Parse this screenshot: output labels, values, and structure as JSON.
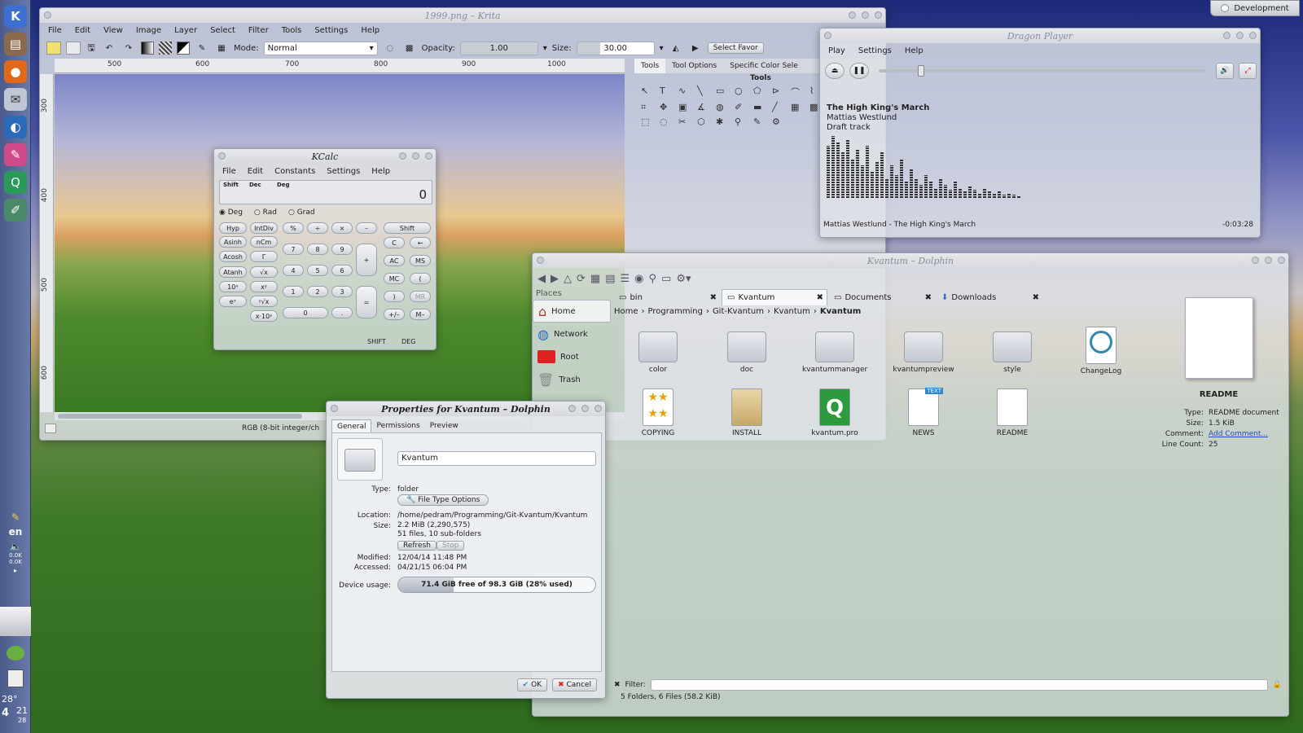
{
  "panel": {
    "lang": "en",
    "net_up": "0.0K",
    "net_down": "0.0K",
    "weather": "28°",
    "clock_min": "21",
    "clock_sec": "28",
    "clock_hour": "4"
  },
  "activity": "Development",
  "krita": {
    "title": "1999.png – Krita",
    "menu": [
      "File",
      "Edit",
      "View",
      "Image",
      "Layer",
      "Select",
      "Filter",
      "Tools",
      "Settings",
      "Help"
    ],
    "mode_label": "Mode:",
    "mode_value": "Normal",
    "opacity_label": "Opacity:",
    "opacity_value": "1.00",
    "size_label": "Size:",
    "size_value": "30.00",
    "select_favorite": "Select Favor",
    "ruler_h": [
      "500",
      "600",
      "700",
      "800",
      "900",
      "1000"
    ],
    "ruler_v": [
      "300",
      "400",
      "500",
      "600"
    ],
    "status": "RGB (8-bit integer/ch",
    "docker_tabs": [
      "Tools",
      "Tool Options",
      "Specific Color Sele"
    ],
    "docker_title": "Tools"
  },
  "kcalc": {
    "title": "KCalc",
    "menu": [
      "File",
      "Edit",
      "Constants",
      "Settings",
      "Help"
    ],
    "status_flags": [
      "Shift",
      "Dec",
      "Deg"
    ],
    "display": "0",
    "angle": [
      "Deg",
      "Rad",
      "Grad"
    ],
    "buttons": {
      "hyp": "Hyp",
      "intdiv": "IntDiv",
      "pct": "%",
      "div": "÷",
      "mul": "×",
      "sub": "–",
      "shift": "Shift",
      "asinh": "Asinh",
      "ncm": "nCm",
      "n7": "7",
      "n8": "8",
      "n9": "9",
      "add": "+",
      "c": "C",
      "back": "←",
      "acosh": "Acosh",
      "gamma": "Γ",
      "n4": "4",
      "n5": "5",
      "n6": "6",
      "ac": "AC",
      "ms": "MS",
      "atanh": "Atanh",
      "sqrt": "√x",
      "n1": "1",
      "n2": "2",
      "n3": "3",
      "mc": "MC",
      "lp": "(",
      "tenx": "10ˣ",
      "xy": "xʸ",
      "n0": "0",
      "dot": ".",
      "eq": "=",
      "rp": ")",
      "mr": "MR",
      "ex": "eˣ",
      "root": "ʸ√x",
      "exp": "x·10ʸ",
      "pm": "+/–",
      "mminus": "M–"
    },
    "footer_shift": "SHIFT",
    "footer_deg": "DEG"
  },
  "dragon": {
    "title": "Dragon Player",
    "menu": [
      "Play",
      "Settings",
      "Help"
    ],
    "track_title": "The High King's March",
    "artist": "Mattias Westlund",
    "album": "Draft track",
    "status": "Mattias Westlund - The High King's March",
    "time": "-0:03:28",
    "progress": 0.12,
    "spectrum": [
      0.8,
      0.95,
      0.85,
      0.7,
      0.9,
      0.6,
      0.75,
      0.5,
      0.8,
      0.4,
      0.55,
      0.7,
      0.3,
      0.5,
      0.35,
      0.6,
      0.25,
      0.45,
      0.3,
      0.2,
      0.35,
      0.25,
      0.15,
      0.3,
      0.2,
      0.12,
      0.25,
      0.15,
      0.1,
      0.18,
      0.12,
      0.08,
      0.14,
      0.1,
      0.06,
      0.1,
      0.05,
      0.08,
      0.05,
      0.04
    ]
  },
  "dolphin": {
    "title": "Kvantum – Dolphin",
    "places_label": "Places",
    "places": [
      "Home",
      "Network",
      "Root",
      "Trash"
    ],
    "tabs": [
      "bin",
      "Kvantum",
      "Documents",
      "Downloads"
    ],
    "breadcrumb": [
      "Home",
      "Programming",
      "Git-Kvantum",
      "Kvantum",
      "Kvantum"
    ],
    "files_row1": [
      "color",
      "doc",
      "kvantummanager",
      "kvantumpreview",
      "style",
      "ChangeLog"
    ],
    "files_row2": [
      "COPYING",
      "INSTALL",
      "kvantum.pro",
      "NEWS",
      "README"
    ],
    "info": {
      "name": "README",
      "type_label": "Type:",
      "type_value": "README document",
      "size_label": "Size:",
      "size_value": "1.5 KiB",
      "comment_label": "Comment:",
      "comment_value": "Add Comment...",
      "lines_label": "Line Count:",
      "lines_value": "25"
    },
    "filter_label": "Filter:",
    "status": "5 Folders, 6 Files (58.2 KiB)"
  },
  "props": {
    "title": "Properties for Kvantum – Dolphin",
    "tabs": [
      "General",
      "Permissions",
      "Preview"
    ],
    "name_value": "Kvantum",
    "type_label": "Type:",
    "type_value": "folder",
    "file_type_options": "File Type Options",
    "location_label": "Location:",
    "location_value": "/home/pedram/Programming/Git-Kvantum/Kvantum",
    "size_label": "Size:",
    "size_value": "2.2 MiB (2,290,575)",
    "size_detail": "51 files, 10 sub-folders",
    "refresh": "Refresh",
    "stop": "Stop",
    "modified_label": "Modified:",
    "modified_value": "12/04/14 11:48 PM",
    "accessed_label": "Accessed:",
    "accessed_value": "04/21/15 06:04 PM",
    "device_label": "Device usage:",
    "device_value": "71.4 GiB free of 98.3 GiB (28% used)",
    "device_used": 0.28,
    "ok": "OK",
    "cancel": "Cancel"
  }
}
